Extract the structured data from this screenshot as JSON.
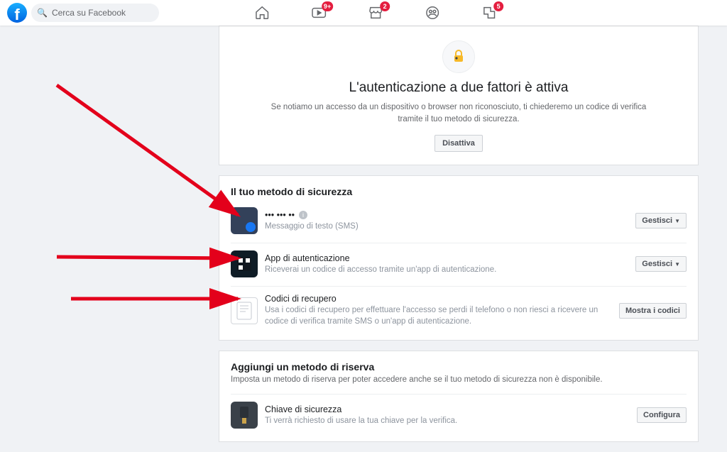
{
  "search": {
    "placeholder": "Cerca su Facebook"
  },
  "nav": {
    "watch_badge": "9+",
    "market_badge": "2",
    "notif_badge": "5"
  },
  "hero": {
    "title": "L'autenticazione a due fattori è attiva",
    "desc": "Se notiamo un accesso da un dispositivo o browser non riconosciuto, ti chiederemo un codice di verifica tramite il tuo metodo di sicurezza.",
    "disable_btn": "Disattiva"
  },
  "security": {
    "heading": "Il tuo metodo di sicurezza",
    "sms": {
      "title": "••• ••• ••",
      "desc": "Messaggio di testo (SMS)",
      "btn": "Gestisci"
    },
    "auth": {
      "title": "App di autenticazione",
      "desc": "Riceverai un codice di accesso tramite un'app di autenticazione.",
      "btn": "Gestisci"
    },
    "codes": {
      "title": "Codici di recupero",
      "desc": "Usa i codici di recupero per effettuare l'accesso se perdi il telefono o non riesci a ricevere un codice di verifica tramite SMS o un'app di autenticazione.",
      "btn": "Mostra i codici"
    }
  },
  "backup": {
    "heading": "Aggiungi un metodo di riserva",
    "sub": "Imposta un metodo di riserva per poter accedere anche se il tuo metodo di sicurezza non è disponibile.",
    "key": {
      "title": "Chiave di sicurezza",
      "desc": "Ti verrà richiesto di usare la tua chiave per la verifica.",
      "btn": "Configura"
    }
  }
}
